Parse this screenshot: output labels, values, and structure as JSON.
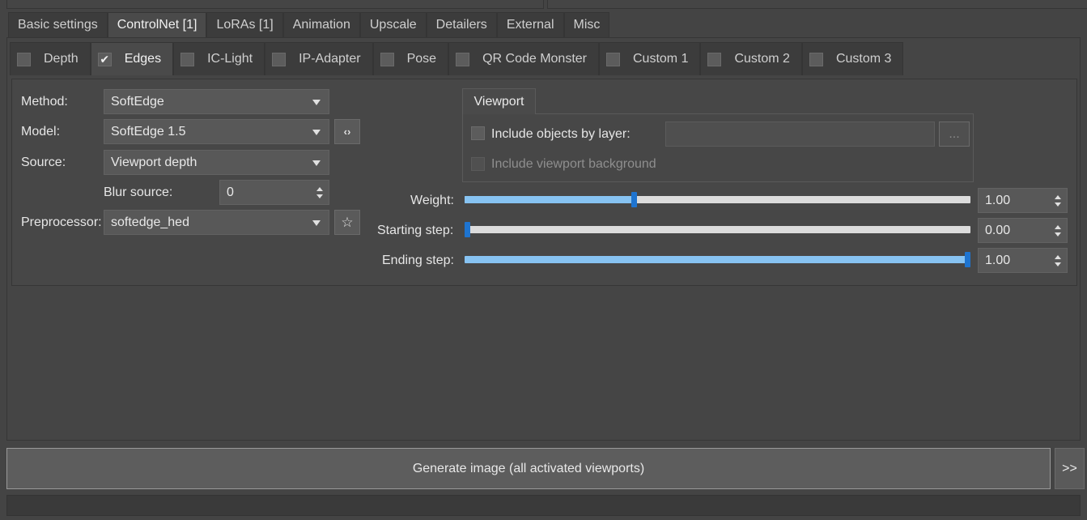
{
  "main_tabs": [
    {
      "label": "Basic settings",
      "active": false
    },
    {
      "label": "ControlNet [1]",
      "active": true
    },
    {
      "label": "LoRAs [1]",
      "active": false
    },
    {
      "label": "Animation",
      "active": false
    },
    {
      "label": "Upscale",
      "active": false
    },
    {
      "label": "Detailers",
      "active": false
    },
    {
      "label": "External",
      "active": false
    },
    {
      "label": "Misc",
      "active": false
    }
  ],
  "sub_tabs": [
    {
      "label": "Depth",
      "checked": false,
      "active": false
    },
    {
      "label": "Edges",
      "checked": true,
      "active": true
    },
    {
      "label": "IC-Light",
      "checked": false,
      "active": false
    },
    {
      "label": "IP-Adapter",
      "checked": false,
      "active": false
    },
    {
      "label": "Pose",
      "checked": false,
      "active": false
    },
    {
      "label": "QR Code Monster",
      "checked": false,
      "active": false
    },
    {
      "label": "Custom 1",
      "checked": false,
      "active": false
    },
    {
      "label": "Custom 2",
      "checked": false,
      "active": false
    },
    {
      "label": "Custom 3",
      "checked": false,
      "active": false
    }
  ],
  "form": {
    "method_label": "Method:",
    "method_value": "SoftEdge",
    "model_label": "Model:",
    "model_value": "SoftEdge 1.5",
    "source_label": "Source:",
    "source_value": "Viewport depth",
    "blur_label": "Blur source:",
    "blur_value": "0",
    "preprocessor_label": "Preprocessor:",
    "preprocessor_value": "softedge_hed"
  },
  "viewport": {
    "tab_label": "Viewport",
    "include_layer_label": "Include objects by layer:",
    "include_layer_value": "",
    "browse_label": "...",
    "include_bg_label": "Include viewport background"
  },
  "sliders": {
    "weight_label": "Weight:",
    "weight_value": "1.00",
    "weight_fraction": 0.333,
    "start_label": "Starting step:",
    "start_value": "0.00",
    "start_fraction": 0.0,
    "end_label": "Ending step:",
    "end_value": "1.00",
    "end_fraction": 1.0
  },
  "actions": {
    "generate_label": "Generate image (all activated viewports)",
    "more_label": ">>"
  },
  "colors": {
    "slider_fill": "#87c3f2",
    "slider_handle": "#1e74d0"
  },
  "icons": {
    "refresh": "refresh-icon",
    "star": "star-icon"
  }
}
